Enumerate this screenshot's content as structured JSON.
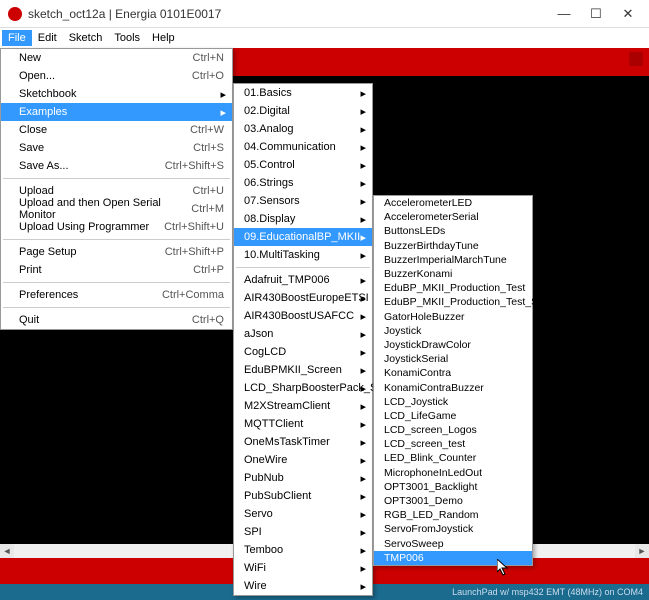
{
  "window": {
    "title": "sketch_oct12a | Energia 0101E0017"
  },
  "menubar": [
    "File",
    "Edit",
    "Sketch",
    "Tools",
    "Help"
  ],
  "menubar_active_index": 0,
  "file_menu": [
    {
      "label": "New",
      "shortcut": "Ctrl+N"
    },
    {
      "label": "Open...",
      "shortcut": "Ctrl+O"
    },
    {
      "label": "Sketchbook",
      "submenu": true
    },
    {
      "label": "Examples",
      "submenu": true,
      "highlighted": true
    },
    {
      "label": "Close",
      "shortcut": "Ctrl+W"
    },
    {
      "label": "Save",
      "shortcut": "Ctrl+S"
    },
    {
      "label": "Save As...",
      "shortcut": "Ctrl+Shift+S"
    },
    {
      "sep": true
    },
    {
      "label": "Upload",
      "shortcut": "Ctrl+U"
    },
    {
      "label": "Upload and then Open Serial Monitor",
      "shortcut": "Ctrl+M"
    },
    {
      "label": "Upload Using Programmer",
      "shortcut": "Ctrl+Shift+U"
    },
    {
      "sep": true
    },
    {
      "label": "Page Setup",
      "shortcut": "Ctrl+Shift+P"
    },
    {
      "label": "Print",
      "shortcut": "Ctrl+P"
    },
    {
      "sep": true
    },
    {
      "label": "Preferences",
      "shortcut": "Ctrl+Comma"
    },
    {
      "sep": true
    },
    {
      "label": "Quit",
      "shortcut": "Ctrl+Q"
    }
  ],
  "examples_menu": [
    {
      "label": "01.Basics",
      "submenu": true
    },
    {
      "label": "02.Digital",
      "submenu": true
    },
    {
      "label": "03.Analog",
      "submenu": true
    },
    {
      "label": "04.Communication",
      "submenu": true
    },
    {
      "label": "05.Control",
      "submenu": true
    },
    {
      "label": "06.Strings",
      "submenu": true
    },
    {
      "label": "07.Sensors",
      "submenu": true
    },
    {
      "label": "08.Display",
      "submenu": true
    },
    {
      "label": "09.EducationalBP_MKII",
      "submenu": true,
      "highlighted": true
    },
    {
      "label": "10.MultiTasking",
      "submenu": true
    },
    {
      "sep": true
    },
    {
      "label": "Adafruit_TMP006",
      "submenu": true
    },
    {
      "label": "AIR430BoostEuropeETSI",
      "submenu": true
    },
    {
      "label": "AIR430BoostUSAFCC",
      "submenu": true
    },
    {
      "label": "aJson",
      "submenu": true
    },
    {
      "label": "CogLCD",
      "submenu": true
    },
    {
      "label": "EduBPMKII_Screen",
      "submenu": true
    },
    {
      "label": "LCD_SharpBoosterPack_SPI",
      "submenu": true
    },
    {
      "label": "M2XStreamClient",
      "submenu": true
    },
    {
      "label": "MQTTClient",
      "submenu": true
    },
    {
      "label": "OneMsTaskTimer",
      "submenu": true
    },
    {
      "label": "OneWire",
      "submenu": true
    },
    {
      "label": "PubNub",
      "submenu": true
    },
    {
      "label": "PubSubClient",
      "submenu": true
    },
    {
      "label": "Servo",
      "submenu": true
    },
    {
      "label": "SPI",
      "submenu": true
    },
    {
      "label": "Temboo",
      "submenu": true
    },
    {
      "label": "WiFi",
      "submenu": true
    },
    {
      "label": "Wire",
      "submenu": true
    }
  ],
  "edu_menu": [
    "AccelerometerLED",
    "AccelerometerSerial",
    "ButtonsLEDs",
    "BuzzerBirthdayTune",
    "BuzzerImperialMarchTune",
    "BuzzerKonami",
    "EduBP_MKII_Production_Test",
    "EduBP_MKII_Production_Test_Serial",
    "GatorHoleBuzzer",
    "Joystick",
    "JoystickDrawColor",
    "JoystickSerial",
    "KonamiContra",
    "KonamiContraBuzzer",
    "LCD_Joystick",
    "LCD_LifeGame",
    "LCD_screen_Logos",
    "LCD_screen_test",
    "LED_Blink_Counter",
    "MicrophoneInLedOut",
    "OPT3001_Backlight",
    "OPT3001_Demo",
    "RGB_LED_Random",
    "ServoFromJoystick",
    "ServoSweep",
    "TMP006"
  ],
  "edu_menu_highlighted_index": 25,
  "statusbar": {
    "text": "LaunchPad w/ msp432 EMT (48MHz) on COM4"
  }
}
